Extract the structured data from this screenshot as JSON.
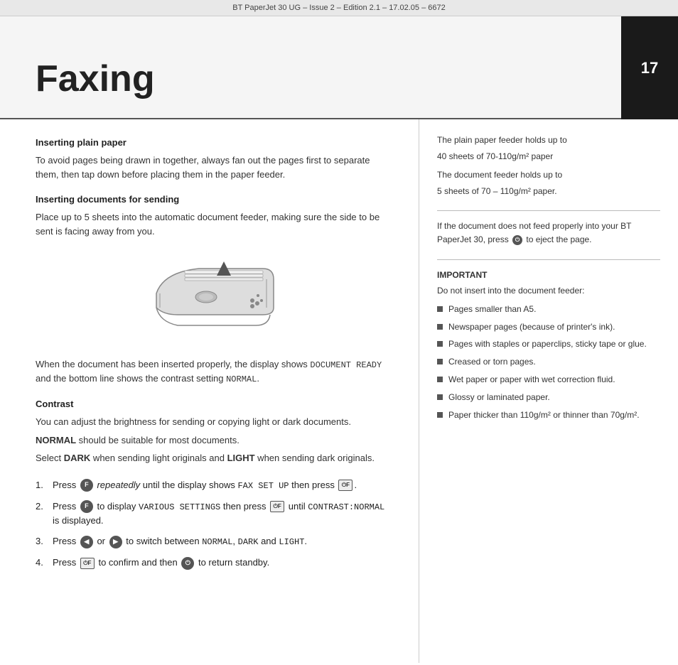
{
  "header": {
    "text": "BT PaperJet 30 UG – Issue 2 – Edition 2.1 – 17.02.05 – 6672"
  },
  "page_number": "17",
  "title": "Faxing",
  "left_col": {
    "section1": {
      "title": "Inserting plain paper",
      "body": "To avoid pages being drawn in together, always fan out the pages first to separate them, then tap down before placing them in the paper feeder."
    },
    "section2": {
      "title": "Inserting documents for sending",
      "body": "Place up to 5 sheets into the automatic document feeder, making sure the side to be sent is facing away from you."
    },
    "after_image": "When the document has been inserted properly, the display shows ",
    "code1": "DOCUMENT READY",
    "after_code1": " and the bottom line shows the contrast setting ",
    "code2": "NORMAL",
    "after_code2": ".",
    "section3": {
      "title": "Contrast",
      "body": "You can adjust the brightness for sending or copying light or dark documents.",
      "line2": "NORMAL should be suitable for most documents.",
      "line3_pre": "Select ",
      "dark": "DARK",
      "line3_mid": " when sending light originals and ",
      "light": "LIGHT",
      "line3_post": " when sending dark originals."
    },
    "steps": [
      {
        "num": "1.",
        "pre": "Press ",
        "key1": "F",
        "mid1": " ",
        "italic": "repeatedly",
        "mid2": " until the display shows ",
        "code": "FAX SET UP",
        "mid3": " then press ",
        "key2": "⏻",
        "end": "."
      },
      {
        "num": "2.",
        "pre": "Press ",
        "key1": "F",
        "mid1": " to display ",
        "code": "VARIOUS SETTINGS",
        "mid2": " then press ",
        "key2": "⏻",
        "mid3": " until ",
        "code2": "CONTRAST:NORMAL",
        "end": " is displayed."
      },
      {
        "num": "3.",
        "pre": "Press ",
        "key1": "◀",
        "mid1": " or ",
        "key2": "▶",
        "mid2": " to switch between ",
        "code1": "NORMAL",
        "mid3": ", ",
        "code2": "DARK",
        "mid4": " and ",
        "code3": "LIGHT",
        "end": "."
      },
      {
        "num": "4.",
        "pre": "Press ",
        "key1": "⏻",
        "mid1": " to confirm and then ",
        "key2": "⏻",
        "end": " to return standby."
      }
    ]
  },
  "right_col": {
    "note1": {
      "line1": "The plain paper feeder holds up to",
      "line2": "40 sheets of 70-110g/m² paper",
      "line3": "The document feeder holds up to",
      "line4": "5 sheets of 70 – 110g/m² paper."
    },
    "note2": {
      "line1": "If the document does not feed properly",
      "line2": "into your BT PaperJet 30, press",
      "key": "⏻",
      "line3": "to eject",
      "line4": "the page."
    },
    "important": {
      "header": "IMPORTANT",
      "subheader": "Do not insert into the document feeder:",
      "items": [
        "Pages smaller than A5.",
        "Newspaper pages (because of printer's ink).",
        "Pages with staples or paperclips, sticky tape or glue.",
        "Creased or torn pages.",
        "Wet paper or paper with wet correction fluid.",
        "Glossy or laminated paper.",
        "Paper thicker than 110g/m² or thinner than 70g/m²."
      ]
    }
  }
}
